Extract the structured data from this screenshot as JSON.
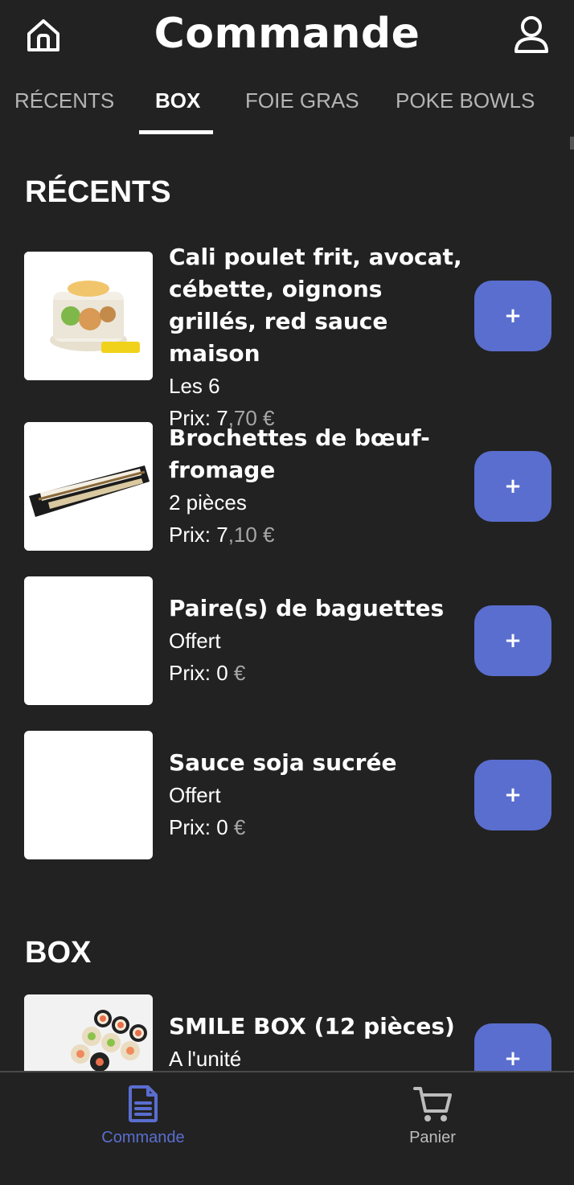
{
  "header": {
    "title": "Commande",
    "home_icon": "home-icon",
    "profile_icon": "user-icon"
  },
  "tabs": [
    {
      "label": "RÉCENTS",
      "active": false
    },
    {
      "label": "BOX",
      "active": true
    },
    {
      "label": "FOIE GRAS",
      "active": false
    },
    {
      "label": "POKE BOWLS",
      "active": false
    }
  ],
  "sections": {
    "recents": {
      "title": "RÉCENTS",
      "items": [
        {
          "name": "Cali poulet frit, avocat, cébette, oignons grillés, red sauce maison",
          "desc": "Les 6",
          "price_label": "Prix: 7",
          "price_suffix": ",70 €",
          "add_label": "+"
        },
        {
          "name": "Brochettes de bœuf-fromage",
          "desc": "2 pièces",
          "price_label": "Prix: 7",
          "price_suffix": ",10 €",
          "add_label": "+"
        },
        {
          "name": "Paire(s) de baguettes",
          "desc": "Offert",
          "price_label": "Prix: 0",
          "price_suffix": " €",
          "add_label": "+"
        },
        {
          "name": "Sauce soja sucrée",
          "desc": "Offert",
          "price_label": "Prix: 0",
          "price_suffix": " €",
          "add_label": "+"
        }
      ]
    },
    "box": {
      "title": "BOX",
      "items": [
        {
          "name": "SMILE BOX (12 pièces)",
          "desc": "A l'unité",
          "add_label": "+"
        }
      ]
    }
  },
  "bottom_nav": {
    "items": [
      {
        "label": "Commande",
        "icon": "document-icon",
        "active": true
      },
      {
        "label": "Panier",
        "icon": "cart-icon",
        "active": false
      }
    ]
  },
  "colors": {
    "background": "#222222",
    "accent": "#5a6ecf",
    "text": "#ffffff",
    "muted": "#a7a7a7"
  }
}
